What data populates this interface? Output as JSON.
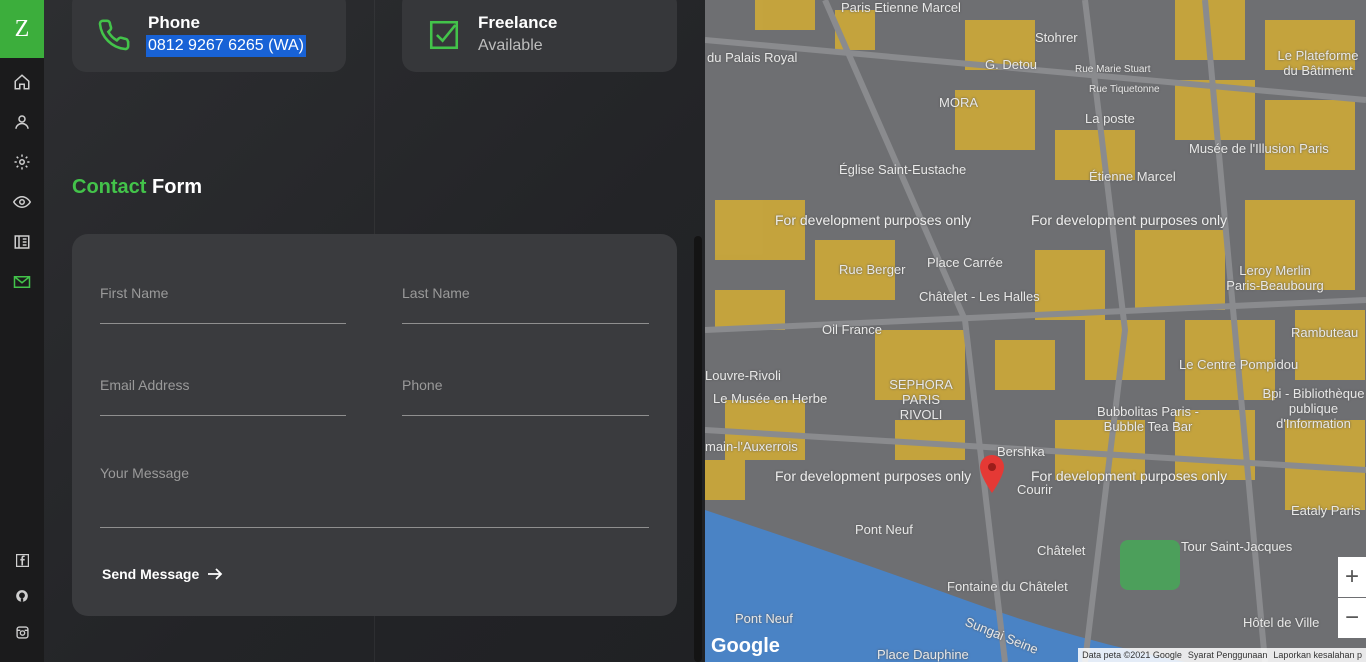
{
  "sidebar": {
    "logo": "Z",
    "nav": [
      {
        "icon": "home-icon"
      },
      {
        "icon": "user-icon"
      },
      {
        "icon": "gear-icon"
      },
      {
        "icon": "eye-icon"
      },
      {
        "icon": "portfolio-icon"
      },
      {
        "icon": "mail-icon",
        "active": true
      }
    ],
    "social": [
      "facebook-icon",
      "github-icon",
      "instagram-icon"
    ]
  },
  "cards": {
    "phone": {
      "title": "Phone",
      "value": "0812 9267 6265 (WA)"
    },
    "freelance": {
      "title": "Freelance",
      "value": "Available"
    }
  },
  "contact": {
    "title_accent": "Contact",
    "title_rest": "Form",
    "fields": {
      "first_name": "First Name",
      "last_name": "Last Name",
      "email": "Email Address",
      "phone": "Phone",
      "message": "Your Message"
    },
    "send_label": "Send Message"
  },
  "map": {
    "places": [
      "Paris Etienne Marcel",
      "Stohrer",
      "du Palais Royal",
      "G. Detou",
      "Rue Marie Stuart",
      "MORA",
      "Rue Tiquetonne",
      "La poste",
      "Église Saint-Eustache",
      "Musée de l'Illusion Paris",
      "Étienne Marcel",
      "Place Carrée",
      "Rue Berger",
      "Châtelet - Les Halles",
      "Leroy Merlin Paris-Beaubourg",
      "Oil France",
      "Rambuteau",
      "Le Centre Pompidou",
      "SEPHORA PARIS RIVOLI",
      "Le Musée en Herbe",
      "Bubbolitas Paris - Bubble Tea Bar",
      "Bershka",
      "Courir",
      "Pont Neuf",
      "Châtelet",
      "Tour Saint-Jacques",
      "Fontaine du Châtelet",
      "Pont Neuf",
      "Place Dauphine",
      "Hôtel de Ville",
      "Sungai Seine",
      "Le Plateforme du Bâtiment",
      "Bpi - Bibliothèque publique d'Information",
      "Louvre-Rivoli",
      "main-l'Auxerrois",
      "Eataly Paris"
    ],
    "dev_notice": "For development purposes only",
    "zoom_in": "+",
    "zoom_out": "−",
    "attribution": [
      "Data peta ©2021 Google",
      "Syarat Penggunaan",
      "Laporkan kesalahan p"
    ],
    "brand": "Google",
    "colors": {
      "building": "#c9a63b",
      "water": "#4a83c5",
      "park": "#4c9f5b",
      "marker": "#e53935"
    }
  },
  "colors": {
    "accent": "#43c34a",
    "selection": "#1862d6"
  }
}
